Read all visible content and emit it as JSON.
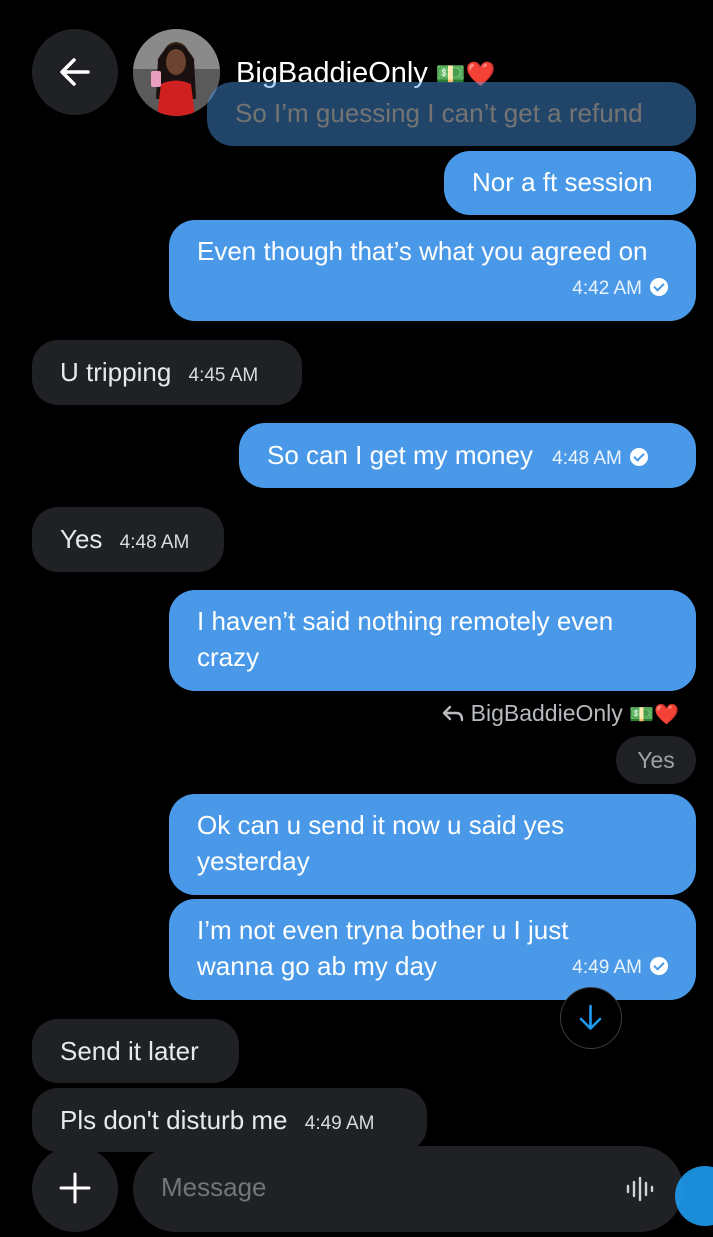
{
  "header": {
    "contact_name": "BigBaddieOnly",
    "name_emojis": "💵❤️",
    "back_icon": "arrow-left-icon"
  },
  "messages": [
    {
      "dir": "out",
      "text": "So I’m guessing I can’t get a refund",
      "time": ""
    },
    {
      "dir": "out",
      "text": "Nor a ft session",
      "time": ""
    },
    {
      "dir": "out",
      "text": "Even though that’s what you agreed on",
      "time": "4:42 AM",
      "seen": true
    },
    {
      "dir": "in",
      "text": "U tripping",
      "time": "4:45 AM"
    },
    {
      "dir": "out",
      "text": "So can I get my money",
      "time": "4:48 AM",
      "seen": true
    },
    {
      "dir": "in",
      "text": "Yes",
      "time": "4:48 AM"
    },
    {
      "dir": "out",
      "text": "I haven’t said nothing remotely even crazy",
      "time": ""
    },
    {
      "dir": "out",
      "text": "Ok can u send it now u said yes yesterday",
      "time": ""
    },
    {
      "dir": "out",
      "text": "I’m not even tryna bother u I just wanna go ab my day",
      "time": "4:49 AM",
      "seen": true
    },
    {
      "dir": "in",
      "text": "Send it later",
      "time": ""
    },
    {
      "dir": "in",
      "text": "Pls don't disturb me",
      "time": "4:49 AM"
    }
  ],
  "reply_context": {
    "replying_to": "BigBaddieOnly",
    "emojis": "💵❤️",
    "quoted_text": "Yes",
    "icon": "reply-arrow-icon"
  },
  "composer": {
    "placeholder": "Message",
    "add_icon": "plus-icon",
    "voice_icon": "waveform-icon"
  },
  "scroll_down_icon": "arrow-down-icon",
  "colors": {
    "background": "#000000",
    "outgoing_bubble": "#4a99e9",
    "incoming_bubble": "#1f2125",
    "accent": "#1d9bf0"
  }
}
